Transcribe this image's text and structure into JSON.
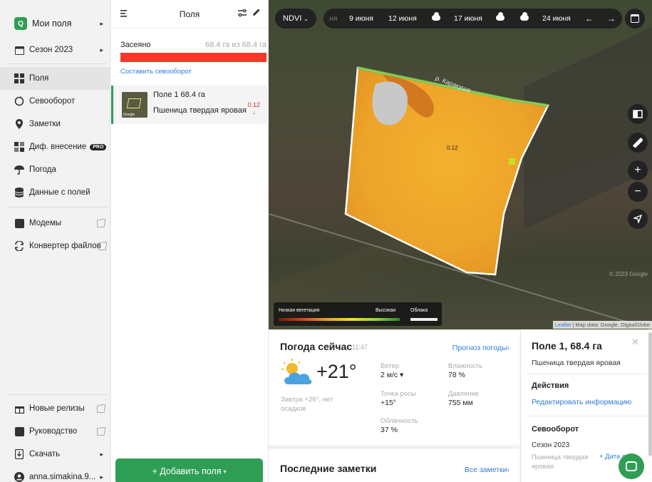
{
  "nav": {
    "my_fields": "Мои поля",
    "season": "Сезон 2023",
    "items": [
      {
        "label": "Поля"
      },
      {
        "label": "Севооборот"
      },
      {
        "label": "Заметки"
      },
      {
        "label": "Диф. внесение",
        "badge": "PRO"
      },
      {
        "label": "Погода"
      },
      {
        "label": "Данные с полей"
      }
    ],
    "modems": "Модемы",
    "converter": "Конвертер файлов",
    "new_releases": "Новые релизы",
    "guide": "Руководство",
    "download": "Скачать",
    "user": "anna.simakina.9..."
  },
  "fields_panel": {
    "title": "Поля",
    "sown_label": "Засеяно",
    "sown_amount": "68.4 га из 68.4 га",
    "sown_fraction": 1.0,
    "rotation_link": "Составить севооборот",
    "field": {
      "name": "Поле 1 68.4 га",
      "crop": "Пшеница твердая яровая",
      "ndvi": "0.12",
      "trend": "↓",
      "thumb_label": "Google"
    },
    "add_button": "+ Добавить поля"
  },
  "map": {
    "index_selector": "NDVI",
    "dates": [
      "9 июня",
      "12 июня",
      "17 июня",
      "24 июня"
    ],
    "river_label": "р. Каракуша",
    "field_value": "0.12",
    "legend": {
      "low": "Низкая вегетация",
      "high": "Высокая",
      "clouds": "Облака"
    },
    "attribution_link": "Leaflet",
    "attribution_text": " | Map data: Google, DigitalGlobe",
    "copyright": "© 2023 Google",
    "colors": {
      "field_main": "#f0a92a",
      "field_dark": "#c86a1e",
      "accent": "#2f9e55"
    }
  },
  "weather": {
    "title": "Погода сейчас",
    "time": "11:47",
    "forecast_link": "Прогноз погоды›",
    "temp": "+21°",
    "tomorrow": "Завтра +26°, нет осадков",
    "wind_label": "Ветер",
    "wind_value": "2 м/с ▾",
    "humidity_label": "Влажность",
    "humidity_value": "78 %",
    "dew_label": "Точка росы",
    "dew_value": "+15°",
    "pressure_label": "Давление",
    "pressure_value": "755 мм",
    "cloud_label": "Облачность",
    "cloud_value": "37 %"
  },
  "notes": {
    "title": "Последние заметки",
    "link": "Все заметки›"
  },
  "field_info": {
    "title": "Поле 1, 68.4 га",
    "crop": "Пшеница твердая яровая",
    "actions_title": "Действия",
    "edit_link": "Редактировать информацию",
    "rotation_title": "Севооборот",
    "season": "Сезон 2023",
    "crop_season": "Пшеница твердая яровая",
    "add_date": "+ Дата с"
  }
}
